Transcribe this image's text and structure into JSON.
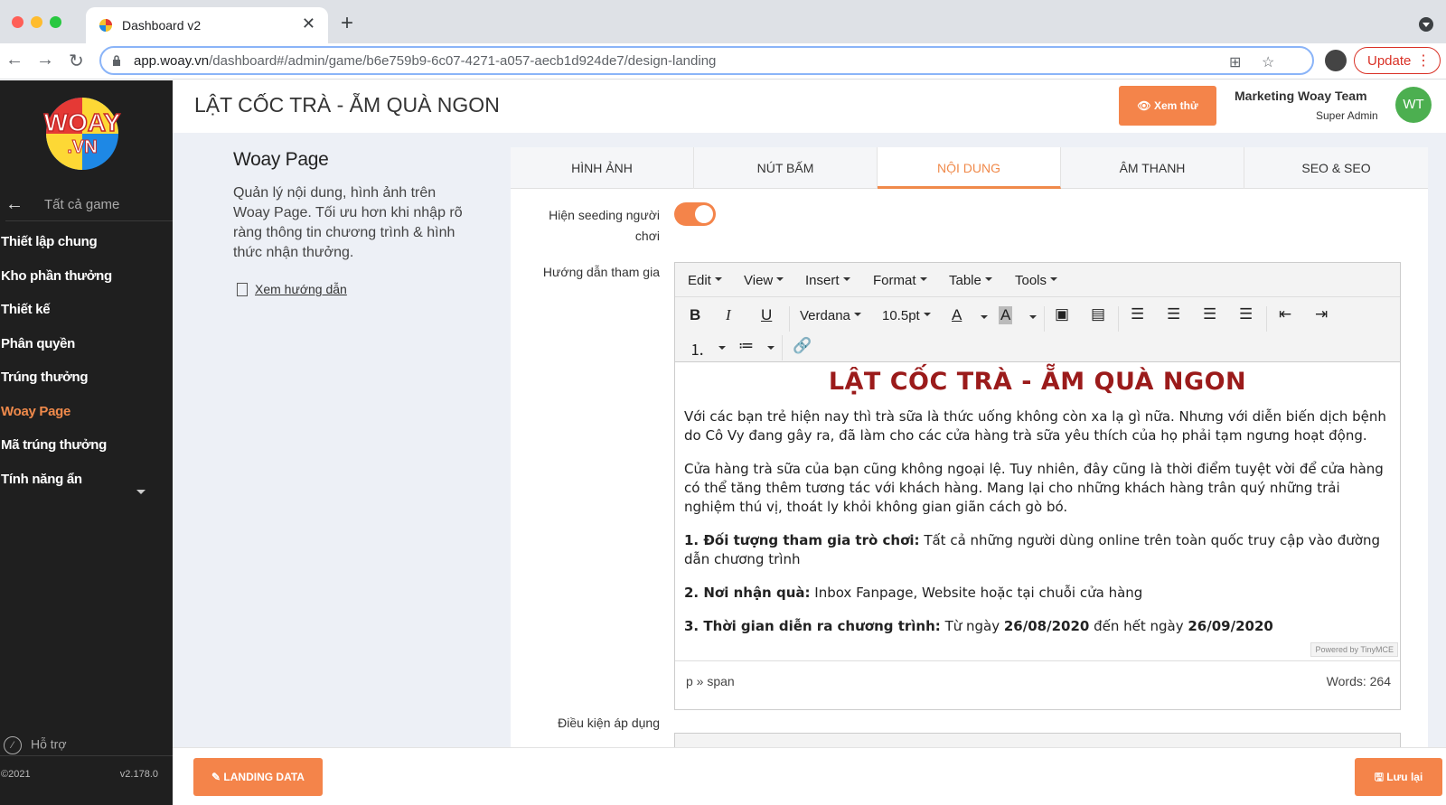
{
  "browser": {
    "tab_title": "Dashboard v2",
    "url_host": "app.woay.vn",
    "url_path": "/dashboard#/admin/game/b6e759b9-6c07-4271-a057-aecb1d924de7/design-landing",
    "update_label": "Update"
  },
  "sidebar": {
    "back_label": "Tất cả game",
    "items": [
      {
        "label": "Thiết lập chung"
      },
      {
        "label": "Kho phần thưởng"
      },
      {
        "label": "Thiết kế"
      },
      {
        "label": "Phân quyền"
      },
      {
        "label": "Trúng thưởng"
      },
      {
        "label": "Woay Page",
        "active": true
      },
      {
        "label": "Mã trúng thưởng"
      },
      {
        "label": "Tính năng ẩn"
      }
    ],
    "support_label": "Hỗ trợ",
    "copyright": "©2021",
    "version": "v2.178.0"
  },
  "header": {
    "title": "LẬT CỐC TRÀ - ẴM QUÀ NGON",
    "preview_label": "Xem thử",
    "user_name": "Marketing Woay Team",
    "user_role": "Super Admin",
    "avatar_initials": "WT"
  },
  "intro": {
    "title": "Woay Page",
    "description": "Quản lý nội dung, hình ảnh trên Woay Page. Tối ưu hơn khi nhập rõ ràng thông tin chương trình & hình thức nhận thưởng.",
    "guide_link": "Xem hướng dẫn"
  },
  "tabs": [
    {
      "label": "HÌNH ẢNH"
    },
    {
      "label": "NÚT BẤM"
    },
    {
      "label": "NỘI DUNG",
      "active": true
    },
    {
      "label": "ÂM THANH"
    },
    {
      "label": "SEO & SEO"
    }
  ],
  "form": {
    "seeding_label_1": "Hiện seeding người",
    "seeding_label_2": "chơi",
    "seeding_enabled": true,
    "guide_label": "Hướng dẫn tham gia",
    "conditions_label": "Điều kiện áp dụng"
  },
  "editor": {
    "menus": [
      "Edit",
      "View",
      "Insert",
      "Format",
      "Table",
      "Tools"
    ],
    "font_family": "Verdana",
    "font_size": "10.5pt",
    "heading": "LẬT CỐC TRÀ - ẴM QUÀ NGON",
    "para1": "Với các bạn trẻ hiện nay thì trà sữa là thức uống không còn xa lạ gì nữa. Nhưng với diễn biến dịch bệnh do Cô Vy đang gây ra, đã làm cho các cửa hàng trà sữa yêu thích của họ phải tạm ngưng hoạt động.",
    "para2": "Cửa hàng trà sữa của bạn cũng không ngoại lệ. Tuy nhiên, đây cũng là thời điểm tuyệt vời để cửa hàng có thể tăng thêm tương tác với khách hàng. Mang lại cho những khách hàng trân quý những trải nghiệm thú vị, thoát ly khỏi không gian giãn cách gò bó.",
    "item1_bold": "1. Đối tượng tham gia trò chơi:",
    "item1_text": " Tất cả những người dùng online trên toàn quốc truy cập vào đường dẫn chương trình",
    "item2_bold": "2. Nơi nhận quà:",
    "item2_text": " Inbox Fanpage, Website hoặc tại chuỗi cửa hàng",
    "item3_bold": "3. Thời gian diễn ra chương trình:",
    "item3_text1": " Từ ngày ",
    "item3_date1": "26/08/2020",
    "item3_text2": " đến hết ngày ",
    "item3_date2": "26/09/2020",
    "powered_by": "Powered by TinyMCE",
    "status_path": "p » span",
    "word_count": "Words: 264"
  },
  "bottom": {
    "landing_label": "LANDING DATA",
    "save_label": "Lưu lại"
  }
}
